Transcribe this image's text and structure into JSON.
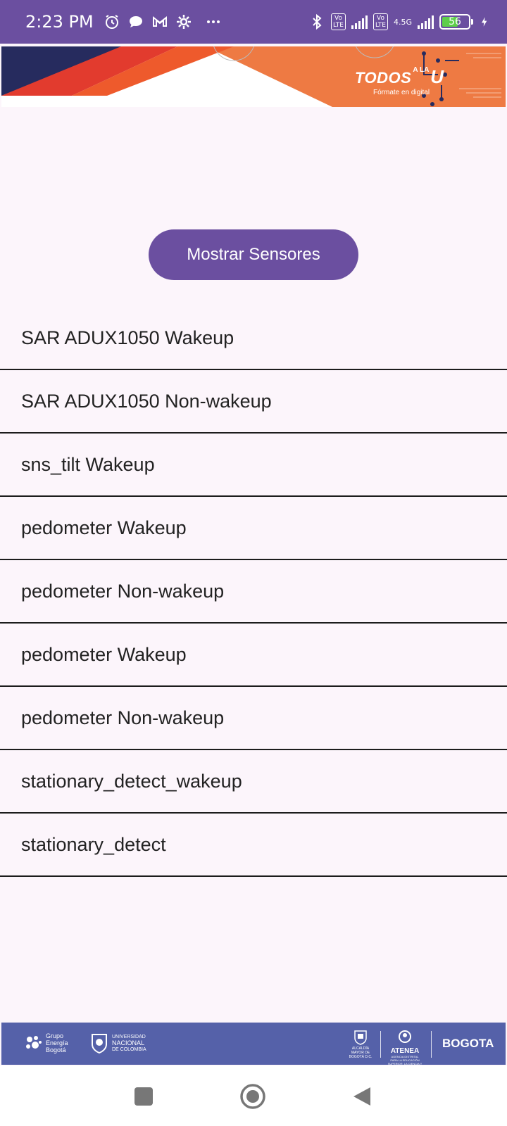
{
  "status_bar": {
    "time": "2:23 PM",
    "lte1": "Vo\nLTE",
    "lte2": "Vo\nLTE",
    "network_type": "4.5G",
    "battery_level": "56"
  },
  "banner": {
    "logo_main": "TODOS",
    "logo_mid": "A LA",
    "logo_end": "U",
    "tagline": "Fórmate en digital"
  },
  "show_button_label": "Mostrar Sensores",
  "sensors": [
    "SAR ADUX1050  Wakeup",
    "SAR ADUX1050  Non-wakeup",
    "sns_tilt  Wakeup",
    "pedometer  Wakeup",
    "pedometer  Non-wakeup",
    "pedometer  Wakeup",
    "pedometer  Non-wakeup",
    "stationary_detect_wakeup",
    "stationary_detect"
  ],
  "footer": {
    "geb": [
      "Grupo",
      "Energía",
      "Bogotá"
    ],
    "unal": [
      "UNIVERSIDAD",
      "NACIONAL",
      "DE COLOMBIA"
    ],
    "alcaldia": "ALCALDÍA MAYOR DE BOGOTÁ D.C.",
    "atenea_name": "ATENEA",
    "atenea_small": "AGENCIA DISTRITAL PARA LA EDUCACIÓN SUPERIOR, LA CIENCIA Y LA TECNOLOGÍA",
    "bogota": "BOGOTA"
  },
  "colors": {
    "primary": "#6b4fa0",
    "background": "#fcf5fb",
    "footer_band": "#5561a9",
    "banner_orange": "#ee7a43",
    "banner_navy": "#262b5e",
    "banner_red": "#e23b2e"
  }
}
